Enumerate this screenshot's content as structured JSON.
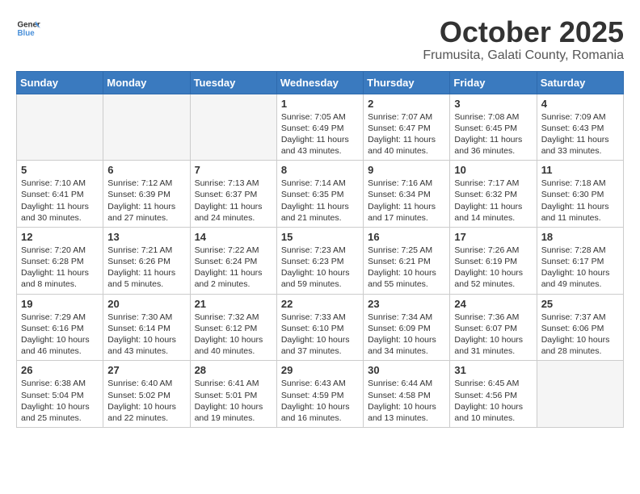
{
  "header": {
    "logo_general": "General",
    "logo_blue": "Blue",
    "month": "October 2025",
    "location": "Frumusita, Galati County, Romania"
  },
  "columns": [
    "Sunday",
    "Monday",
    "Tuesday",
    "Wednesday",
    "Thursday",
    "Friday",
    "Saturday"
  ],
  "weeks": [
    [
      {
        "day": "",
        "text": ""
      },
      {
        "day": "",
        "text": ""
      },
      {
        "day": "",
        "text": ""
      },
      {
        "day": "1",
        "text": "Sunrise: 7:05 AM\nSunset: 6:49 PM\nDaylight: 11 hours\nand 43 minutes."
      },
      {
        "day": "2",
        "text": "Sunrise: 7:07 AM\nSunset: 6:47 PM\nDaylight: 11 hours\nand 40 minutes."
      },
      {
        "day": "3",
        "text": "Sunrise: 7:08 AM\nSunset: 6:45 PM\nDaylight: 11 hours\nand 36 minutes."
      },
      {
        "day": "4",
        "text": "Sunrise: 7:09 AM\nSunset: 6:43 PM\nDaylight: 11 hours\nand 33 minutes."
      }
    ],
    [
      {
        "day": "5",
        "text": "Sunrise: 7:10 AM\nSunset: 6:41 PM\nDaylight: 11 hours\nand 30 minutes."
      },
      {
        "day": "6",
        "text": "Sunrise: 7:12 AM\nSunset: 6:39 PM\nDaylight: 11 hours\nand 27 minutes."
      },
      {
        "day": "7",
        "text": "Sunrise: 7:13 AM\nSunset: 6:37 PM\nDaylight: 11 hours\nand 24 minutes."
      },
      {
        "day": "8",
        "text": "Sunrise: 7:14 AM\nSunset: 6:35 PM\nDaylight: 11 hours\nand 21 minutes."
      },
      {
        "day": "9",
        "text": "Sunrise: 7:16 AM\nSunset: 6:34 PM\nDaylight: 11 hours\nand 17 minutes."
      },
      {
        "day": "10",
        "text": "Sunrise: 7:17 AM\nSunset: 6:32 PM\nDaylight: 11 hours\nand 14 minutes."
      },
      {
        "day": "11",
        "text": "Sunrise: 7:18 AM\nSunset: 6:30 PM\nDaylight: 11 hours\nand 11 minutes."
      }
    ],
    [
      {
        "day": "12",
        "text": "Sunrise: 7:20 AM\nSunset: 6:28 PM\nDaylight: 11 hours\nand 8 minutes."
      },
      {
        "day": "13",
        "text": "Sunrise: 7:21 AM\nSunset: 6:26 PM\nDaylight: 11 hours\nand 5 minutes."
      },
      {
        "day": "14",
        "text": "Sunrise: 7:22 AM\nSunset: 6:24 PM\nDaylight: 11 hours\nand 2 minutes."
      },
      {
        "day": "15",
        "text": "Sunrise: 7:23 AM\nSunset: 6:23 PM\nDaylight: 10 hours\nand 59 minutes."
      },
      {
        "day": "16",
        "text": "Sunrise: 7:25 AM\nSunset: 6:21 PM\nDaylight: 10 hours\nand 55 minutes."
      },
      {
        "day": "17",
        "text": "Sunrise: 7:26 AM\nSunset: 6:19 PM\nDaylight: 10 hours\nand 52 minutes."
      },
      {
        "day": "18",
        "text": "Sunrise: 7:28 AM\nSunset: 6:17 PM\nDaylight: 10 hours\nand 49 minutes."
      }
    ],
    [
      {
        "day": "19",
        "text": "Sunrise: 7:29 AM\nSunset: 6:16 PM\nDaylight: 10 hours\nand 46 minutes."
      },
      {
        "day": "20",
        "text": "Sunrise: 7:30 AM\nSunset: 6:14 PM\nDaylight: 10 hours\nand 43 minutes."
      },
      {
        "day": "21",
        "text": "Sunrise: 7:32 AM\nSunset: 6:12 PM\nDaylight: 10 hours\nand 40 minutes."
      },
      {
        "day": "22",
        "text": "Sunrise: 7:33 AM\nSunset: 6:10 PM\nDaylight: 10 hours\nand 37 minutes."
      },
      {
        "day": "23",
        "text": "Sunrise: 7:34 AM\nSunset: 6:09 PM\nDaylight: 10 hours\nand 34 minutes."
      },
      {
        "day": "24",
        "text": "Sunrise: 7:36 AM\nSunset: 6:07 PM\nDaylight: 10 hours\nand 31 minutes."
      },
      {
        "day": "25",
        "text": "Sunrise: 7:37 AM\nSunset: 6:06 PM\nDaylight: 10 hours\nand 28 minutes."
      }
    ],
    [
      {
        "day": "26",
        "text": "Sunrise: 6:38 AM\nSunset: 5:04 PM\nDaylight: 10 hours\nand 25 minutes."
      },
      {
        "day": "27",
        "text": "Sunrise: 6:40 AM\nSunset: 5:02 PM\nDaylight: 10 hours\nand 22 minutes."
      },
      {
        "day": "28",
        "text": "Sunrise: 6:41 AM\nSunset: 5:01 PM\nDaylight: 10 hours\nand 19 minutes."
      },
      {
        "day": "29",
        "text": "Sunrise: 6:43 AM\nSunset: 4:59 PM\nDaylight: 10 hours\nand 16 minutes."
      },
      {
        "day": "30",
        "text": "Sunrise: 6:44 AM\nSunset: 4:58 PM\nDaylight: 10 hours\nand 13 minutes."
      },
      {
        "day": "31",
        "text": "Sunrise: 6:45 AM\nSunset: 4:56 PM\nDaylight: 10 hours\nand 10 minutes."
      },
      {
        "day": "",
        "text": ""
      }
    ]
  ]
}
